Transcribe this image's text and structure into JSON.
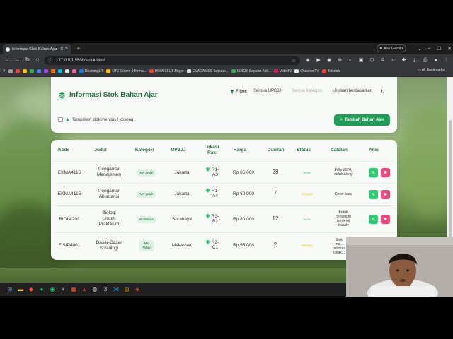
{
  "browser": {
    "tab_title": "Informasi Stok Bahan Ajar - SIT",
    "new_tab": "+",
    "ask_gemini": "Ask Gemini",
    "url": "127.0.0.1:5500/stock.html",
    "bookmarks": [
      "DeamingUT",
      "UT | Sistem Informa...",
      "HIMA SI UT Bogor",
      "OVAGAMES Seputar...",
      "ISNOY Seputar Apli...",
      "VidioTV",
      "OkezoneTV",
      "Tekotok"
    ],
    "all_bookmarks": "All Bookmarks"
  },
  "header": {
    "title": "Informasi Stok Bahan Ajar",
    "filter_label": "Filter:",
    "filter_upbjj": "Semua UPBJJ",
    "filter_kategori": "Semua Kategori",
    "sort_label": "Urutkan berdasarkan",
    "low_stock_label": "Tampilkan stok menipis / kosong",
    "add_button": "Tambah Bahan Ajar"
  },
  "table": {
    "columns": [
      "Kode",
      "Judul",
      "Kategori",
      "UPBJJ",
      "Lokasi Rak",
      "Harga",
      "Jumlah",
      "Status",
      "Catatan",
      "Aksi"
    ],
    "rows": [
      {
        "kode": "EKMA4116",
        "judul": "Pengantar Manajemen",
        "kategori": "MK Wajib",
        "upbjj": "Jakarta",
        "rak": "R1-A3",
        "harga": "Rp 65.000",
        "jumlah": "28",
        "status": "Aman",
        "catatan": "Edisi 2024, cetak ulang"
      },
      {
        "kode": "EKMA4115",
        "judul": "Pengantar Akuntansi",
        "kategori": "MK Wajib",
        "upbjj": "Jakarta",
        "rak": "R1-A4",
        "harga": "Rp 60.000",
        "jumlah": "7",
        "status": "Menipis",
        "catatan": "Cover baru"
      },
      {
        "kode": "BIOL4201",
        "judul": "Biologi Umum (Praktikum)",
        "kategori": "Praktikum",
        "upbjj": "Surabaya",
        "rak": "R3-B2",
        "harga": "Rp 80.000",
        "jumlah": "12",
        "status": "Aman",
        "catatan": "Butuh pendingin untuk kit basah"
      },
      {
        "kode": "FISIP4001",
        "judul": "Dasar-Dasar Sosiologi",
        "kategori": "MK Pilihan",
        "upbjj": "Makassar",
        "rak": "R2-C1",
        "harga": "Rp 55.000",
        "jumlah": "2",
        "status": "Menipis",
        "catatan": "Stok ma... prioritas cetak... mord..."
      }
    ]
  },
  "colors": {
    "primary": "#1e6b3a",
    "accent": "#1f9d55",
    "safe": "#2ecc71",
    "low": "#f1c40f",
    "delete": "#e84a7f"
  }
}
